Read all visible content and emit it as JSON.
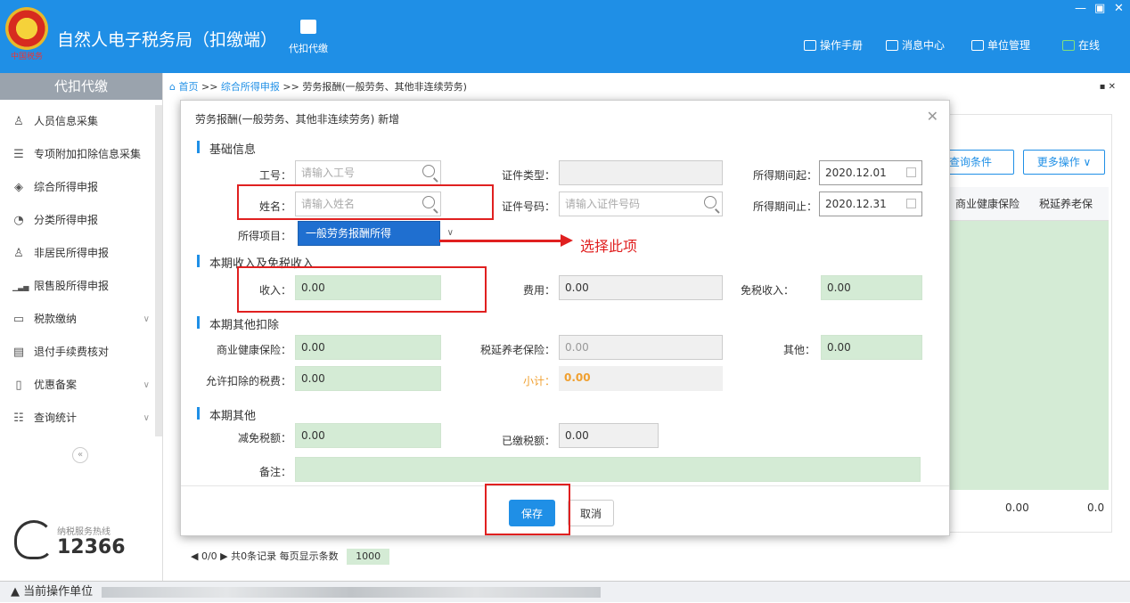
{
  "app": {
    "title": "自然人电子税务局（扣缴端）",
    "emblem_text": "中国税务",
    "module_label": "代扣代缴",
    "top_links": [
      "操作手册",
      "消息中心",
      "单位管理",
      "在线"
    ],
    "window_controls": [
      "—",
      "▣",
      "✕"
    ]
  },
  "sidebar": {
    "header": "代扣代缴",
    "items": [
      {
        "label": "人员信息采集",
        "icon": "person-icon",
        "glyph": "♙",
        "expandable": false
      },
      {
        "label": "专项附加扣除信息采集",
        "icon": "list-icon",
        "glyph": "☰",
        "expandable": false
      },
      {
        "label": "综合所得申报",
        "icon": "layers-icon",
        "glyph": "◈",
        "expandable": false
      },
      {
        "label": "分类所得申报",
        "icon": "pie-icon",
        "glyph": "◔",
        "expandable": false
      },
      {
        "label": "非居民所得申报",
        "icon": "user-icon",
        "glyph": "♙",
        "expandable": false
      },
      {
        "label": "限售股所得申报",
        "icon": "bar-chart-icon",
        "glyph": "▁▃▅",
        "expandable": false
      },
      {
        "label": "税款缴纳",
        "icon": "wallet-icon",
        "glyph": "▭",
        "expandable": true
      },
      {
        "label": "退付手续费核对",
        "icon": "doc-check-icon",
        "glyph": "▤",
        "expandable": false
      },
      {
        "label": "优惠备案",
        "icon": "file-icon",
        "glyph": "▯",
        "expandable": true
      },
      {
        "label": "查询统计",
        "icon": "query-icon",
        "glyph": "☷",
        "expandable": true
      }
    ],
    "collapse_label": "«",
    "hotline_label": "纳税服务热线",
    "hotline_number": "12366"
  },
  "breadcrumb": {
    "home": "首页",
    "sep": ">>",
    "level1": "综合所得申报",
    "level2": "劳务报酬(一般劳务、其他非连续劳务)",
    "close": "▪ ✕"
  },
  "background": {
    "query_btn": "查询条件",
    "more_btn": "更多操作 ∨",
    "col1": "商业健康保险",
    "col2": "税延养老保",
    "foot1": "0.00",
    "foot2": "0.0",
    "pager_text": "◀ 0/0 ▶ 共0条记录  每页显示条数",
    "page_size": "1000"
  },
  "modal": {
    "title": "劳务报酬(一般劳务、其他非连续劳务) 新增",
    "close": "✕",
    "sections": {
      "basic": "基础信息",
      "income": "本期收入及免税收入",
      "deduct": "本期其他扣除",
      "other": "本期其他"
    },
    "fields": {
      "job_no": {
        "label": "工号：",
        "placeholder": "请输入工号"
      },
      "name": {
        "label": "姓名：",
        "placeholder": "请输入姓名"
      },
      "id_type": {
        "label": "证件类型：",
        "value": ""
      },
      "id_no": {
        "label": "证件号码：",
        "placeholder": "请输入证件号码"
      },
      "period_start": {
        "label": "所得期间起：",
        "value": "2020.12.01"
      },
      "period_end": {
        "label": "所得期间止：",
        "value": "2020.12.31"
      },
      "income_item": {
        "label": "所得项目：",
        "value": "一般劳务报酬所得"
      },
      "income": {
        "label": "收入：",
        "value": "0.00"
      },
      "fee": {
        "label": "费用：",
        "value": "0.00"
      },
      "tax_free": {
        "label": "免税收入：",
        "value": "0.00"
      },
      "health_ins": {
        "label": "商业健康保险：",
        "value": "0.00"
      },
      "pension_ins": {
        "label": "税延养老保险：",
        "value": "0.00"
      },
      "other_deduct": {
        "label": "其他：",
        "value": "0.00"
      },
      "allowed_tax": {
        "label": "允许扣除的税费：",
        "value": "0.00"
      },
      "subtotal": {
        "label": "小计：",
        "value": "0.00"
      },
      "tax_reduction": {
        "label": "减免税额：",
        "value": "0.00"
      },
      "paid_tax": {
        "label": "已缴税额：",
        "value": "0.00"
      },
      "remark": {
        "label": "备注：",
        "value": ""
      }
    },
    "annotation": "选择此项",
    "save": "保存",
    "cancel": "取消"
  },
  "status": {
    "label": "当前操作单位"
  },
  "colors": {
    "accent": "#1f8fe6",
    "highlight": "#e02020",
    "green_input": "#d4ebd5"
  }
}
